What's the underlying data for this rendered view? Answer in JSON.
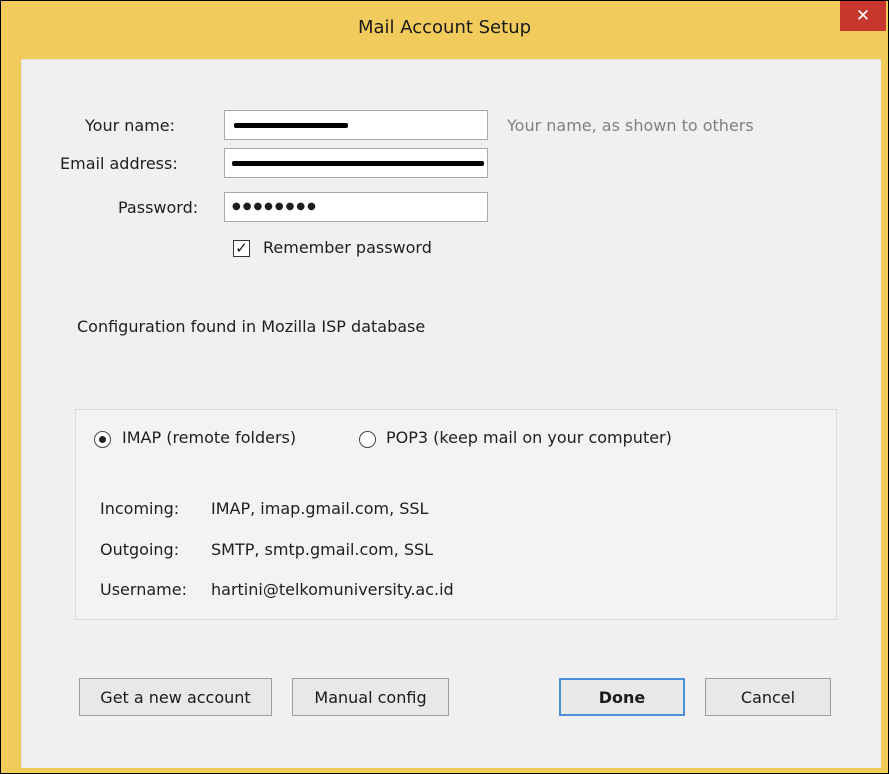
{
  "window": {
    "title": "Mail Account Setup",
    "close_glyph": "✕"
  },
  "form": {
    "name_label": "Your name:",
    "email_label": "Email address:",
    "password_label": "Password:",
    "password_mask": "●●●●●●●●",
    "name_hint": "Your name, as shown to others",
    "remember_label": "Remember password",
    "remember_checked": true
  },
  "status": {
    "message": "Configuration found in Mozilla ISP database"
  },
  "protocol": {
    "imap_label": "IMAP (remote folders)",
    "pop3_label": "POP3 (keep mail on your computer)",
    "selected": "imap"
  },
  "servers": {
    "incoming_label": "Incoming:",
    "incoming_value": "IMAP, imap.gmail.com, SSL",
    "outgoing_label": "Outgoing:",
    "outgoing_value": "SMTP, smtp.gmail.com, SSL",
    "username_label": "Username:",
    "username_value": "hartini@telkomuniversity.ac.id"
  },
  "buttons": {
    "new_account": "Get a new account",
    "manual_config": "Manual config",
    "done": "Done",
    "cancel": "Cancel"
  },
  "colors": {
    "titlebar": "#f1cb5c",
    "close": "#c7372e",
    "default_button_border": "#4e90d8"
  }
}
